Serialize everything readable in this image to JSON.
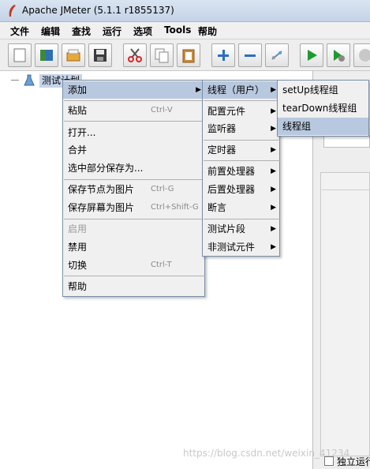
{
  "window": {
    "title": "Apache JMeter (5.1.1 r1855137)"
  },
  "menubar": [
    "文件",
    "编辑",
    "查找",
    "运行",
    "选项",
    "Tools",
    "帮助"
  ],
  "toolbar": [
    {
      "icon": "new-file-icon"
    },
    {
      "icon": "templates-icon"
    },
    {
      "icon": "open-folder-icon"
    },
    {
      "icon": "save-icon"
    },
    {
      "icon": "cut-icon"
    },
    {
      "icon": "copy-icon"
    },
    {
      "icon": "paste-icon"
    },
    {
      "icon": "expand-icon"
    },
    {
      "icon": "collapse-icon"
    },
    {
      "icon": "toggle-icon"
    },
    {
      "icon": "start-icon"
    },
    {
      "icon": "start-no-pauses-icon"
    },
    {
      "icon": "stop-icon"
    }
  ],
  "tree": {
    "root_label": "测试计划"
  },
  "context_menu": {
    "items": [
      {
        "label": "添加",
        "accel": "",
        "submenu": true,
        "highlighted": true,
        "disabled": false
      },
      {
        "label": "粘贴",
        "accel": "Ctrl-V",
        "submenu": false,
        "highlighted": false,
        "disabled": false
      },
      {
        "label": "打开...",
        "accel": "",
        "submenu": false,
        "highlighted": false,
        "disabled": false
      },
      {
        "label": "合并",
        "accel": "",
        "submenu": false,
        "highlighted": false,
        "disabled": false
      },
      {
        "label": "选中部分保存为...",
        "accel": "",
        "submenu": false,
        "highlighted": false,
        "disabled": false
      },
      {
        "label": "保存节点为图片",
        "accel": "Ctrl-G",
        "submenu": false,
        "highlighted": false,
        "disabled": false
      },
      {
        "label": "保存屏幕为图片",
        "accel": "Ctrl+Shift-G",
        "submenu": false,
        "highlighted": false,
        "disabled": false
      },
      {
        "label": "启用",
        "accel": "",
        "submenu": false,
        "highlighted": false,
        "disabled": true
      },
      {
        "label": "禁用",
        "accel": "",
        "submenu": false,
        "highlighted": false,
        "disabled": false
      },
      {
        "label": "切换",
        "accel": "Ctrl-T",
        "submenu": false,
        "highlighted": false,
        "disabled": false
      },
      {
        "label": "帮助",
        "accel": "",
        "submenu": false,
        "highlighted": false,
        "disabled": false
      }
    ]
  },
  "add_menu": {
    "items": [
      {
        "label": "线程（用户）",
        "highlighted": true
      },
      {
        "label": "配置元件",
        "highlighted": false
      },
      {
        "label": "监听器",
        "highlighted": false
      },
      {
        "label": "定时器",
        "highlighted": false
      },
      {
        "label": "前置处理器",
        "highlighted": false
      },
      {
        "label": "后置处理器",
        "highlighted": false
      },
      {
        "label": "断言",
        "highlighted": false
      },
      {
        "label": "测试片段",
        "highlighted": false
      },
      {
        "label": "非测试元件",
        "highlighted": false
      }
    ]
  },
  "threads_menu": {
    "items": [
      {
        "label": "setUp线程组",
        "highlighted": false
      },
      {
        "label": "tearDown线程组",
        "highlighted": false
      },
      {
        "label": "线程组",
        "highlighted": true
      }
    ]
  },
  "right_panel": {
    "checkbox_label": "独立运行"
  },
  "watermark": "https://blog.csdn.net/weixin_41234",
  "colors": {
    "highlight": "#b8c8de",
    "menu_bg": "#f0f0f0",
    "tree_selection": "#c5d4ea"
  }
}
